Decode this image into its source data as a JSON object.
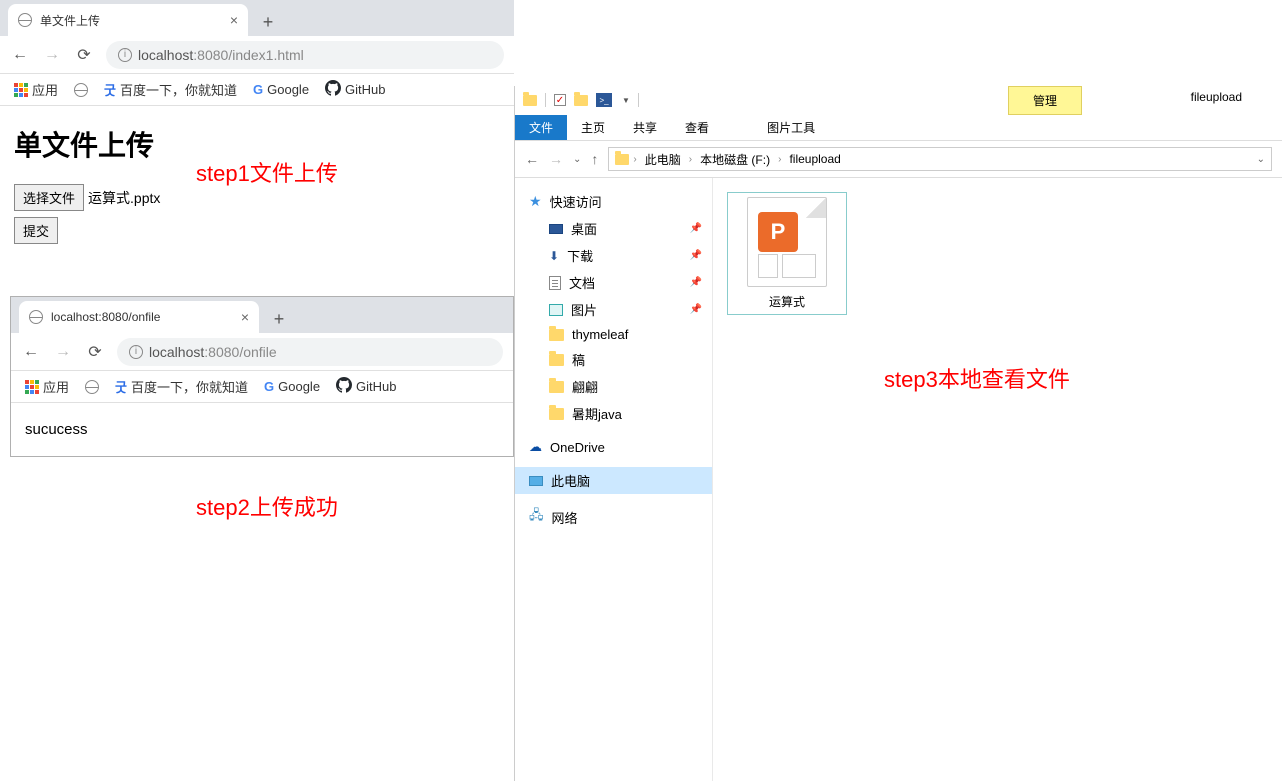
{
  "browser1": {
    "tab_title": "单文件上传",
    "url_host": "localhost",
    "url_port": ":8080",
    "url_path": "/index1.html",
    "bookmarks": {
      "apps": "应用",
      "baidu": "百度一下，你就知道",
      "google": "Google",
      "github": "GitHub"
    },
    "page": {
      "heading": "单文件上传",
      "choose_file": "选择文件",
      "filename": "运算式.pptx",
      "submit": "提交"
    }
  },
  "browser2": {
    "tab_title": "localhost:8080/onfile",
    "url_host": "localhost",
    "url_port": ":8080",
    "url_path": "/onfile",
    "bookmarks": {
      "apps": "应用",
      "baidu": "百度一下，你就知道",
      "google": "Google",
      "github": "GitHub"
    },
    "page": {
      "body": "sucucess"
    }
  },
  "explorer": {
    "window_title": "fileupload",
    "manage": "管理",
    "tabs": {
      "file": "文件",
      "home": "主页",
      "share": "共享",
      "view": "查看",
      "pictools": "图片工具"
    },
    "breadcrumb": [
      "此电脑",
      "本地磁盘 (F:)",
      "fileupload"
    ],
    "sidebar": {
      "quick_access": "快速访问",
      "desktop": "桌面",
      "downloads": "下载",
      "documents": "文档",
      "pictures": "图片",
      "thymeleaf": "thymeleaf",
      "gao": "稿",
      "feifei": "翩翩",
      "summer_java": "暑期java",
      "onedrive": "OneDrive",
      "this_pc": "此电脑",
      "network": "网络"
    },
    "file": {
      "name": "运算式"
    }
  },
  "annotations": {
    "step1": "step1文件上传",
    "step2": "step2上传成功",
    "step3": "step3本地查看文件"
  }
}
